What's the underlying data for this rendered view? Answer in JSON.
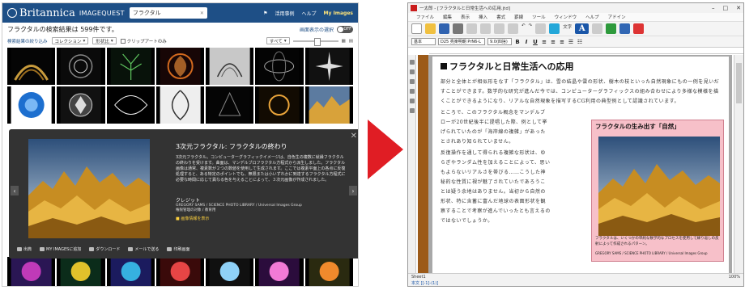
{
  "britannica": {
    "logo": "Britannica",
    "product": "IMAGEQUEST",
    "search_value": "フラクタル",
    "nav": {
      "usage": "活用事例",
      "help": "ヘルプ",
      "my_images": "My Images"
    },
    "results": "フラクタルの検索結果は 599件です。",
    "view_toggle_label": "画面表示の選択",
    "toggle_state": "OFF",
    "filter": {
      "refine": "検索結果の絞り込み",
      "collection": "コレクション",
      "orientation": "形状比",
      "clipart": "クリップアートのみ",
      "all": "すべて"
    },
    "preview": {
      "title": "3次元フラクタル: フラクタルの終わり",
      "description": "3次元フラクタル。コンピューターグラフィックイメージは、自色生の複数に就縁フラクタルの終わりを受けます。曲面は、マンデルブロフラクタル方程式から派生しました。フラクタル画像は通常、複素数が２つの数値を使用して生成されます。ここでは複素平面上の各点に反復処理すると、ある特定のポイントでも、無限または小いずれかに到達するフラクタル方程式に必要な時間に応じて異なる色を与えることによって、３次元画像が作成されました。",
      "credit_label": "クレジット",
      "credit_text": "GREGORY SAMS / SCIENCE PHOTO LIBRARY / Universal Images Group",
      "credit_note": "権限管理の対象 / 教育用",
      "link": "画像情報を表示",
      "actions": [
        "出典",
        "MY IMAGESに追加",
        "ダウンロード",
        "メールで送る",
        "印刷画面"
      ]
    }
  },
  "editor": {
    "window_title": "一太郎 - [フラクタルと日常生活への応用.jtd]",
    "menu": [
      "ファイル",
      "編集",
      "表示",
      "挿入",
      "書式",
      "罫線",
      "ツール",
      "ウィンドウ",
      "ヘルプ",
      "アドイン"
    ],
    "toolbar_text": "文字",
    "style_field": "基本",
    "font_field": "D25 亮楽明朝 PrN6-L",
    "size_field": "9.0(四捨)",
    "doc_title": "フラクタルと日常生活への応用",
    "para1": "部分と全体とが相似形をなす「フラクタル」は、雪の結晶や雲の形状、樹木の枝といった自然現象にもの一例を見いだすことができます。数学的な研究が進んだ今では、コンピューターグラフィックスの組み合わせにより多様な模様を描くことができるようになり、リアルな自然現象を描写するCG利用の典型例として認識されています。",
    "para2": "ところで、このフラクタル概念をマンデルブローが20世紀後半に提唱した際、例として挙げられていたのが「海岸線の複雑」があったとされあり知られていません。",
    "para3": "反復操作を通して得られる複雑な形状は、ゆらぎやランダム性を加えることによって、思いもよらないリアルさを帯びる……こうした神秘的な性質に視が魅了されていたであろうことは疑う余地はありません。当初から自然の形状、特に含蓄に富んだ地球の表面形状を観察することで考察が進んでいったとも言えるのではないでしょうか。",
    "frame_title": "フラクタルの生み出す「自然」",
    "frame_caption": "フラクタルは、いくつかの単純な数学的なプロセスを使用して繰り返しの反射によって作成されるパターン。",
    "frame_credit": "GREGORY SAMS / SCIENCE PHOTO LIBRARY / Universal Images Group",
    "status_sheet": "Sheet1",
    "status_zoom": "100%",
    "status_mode": "本文 [[-1]-(1)]"
  },
  "colors": {
    "header_blue": "#1e4f86",
    "arrow_red": "#e01d24",
    "frame_pink": "#f7c0c9",
    "binder": "#9c5a18"
  }
}
